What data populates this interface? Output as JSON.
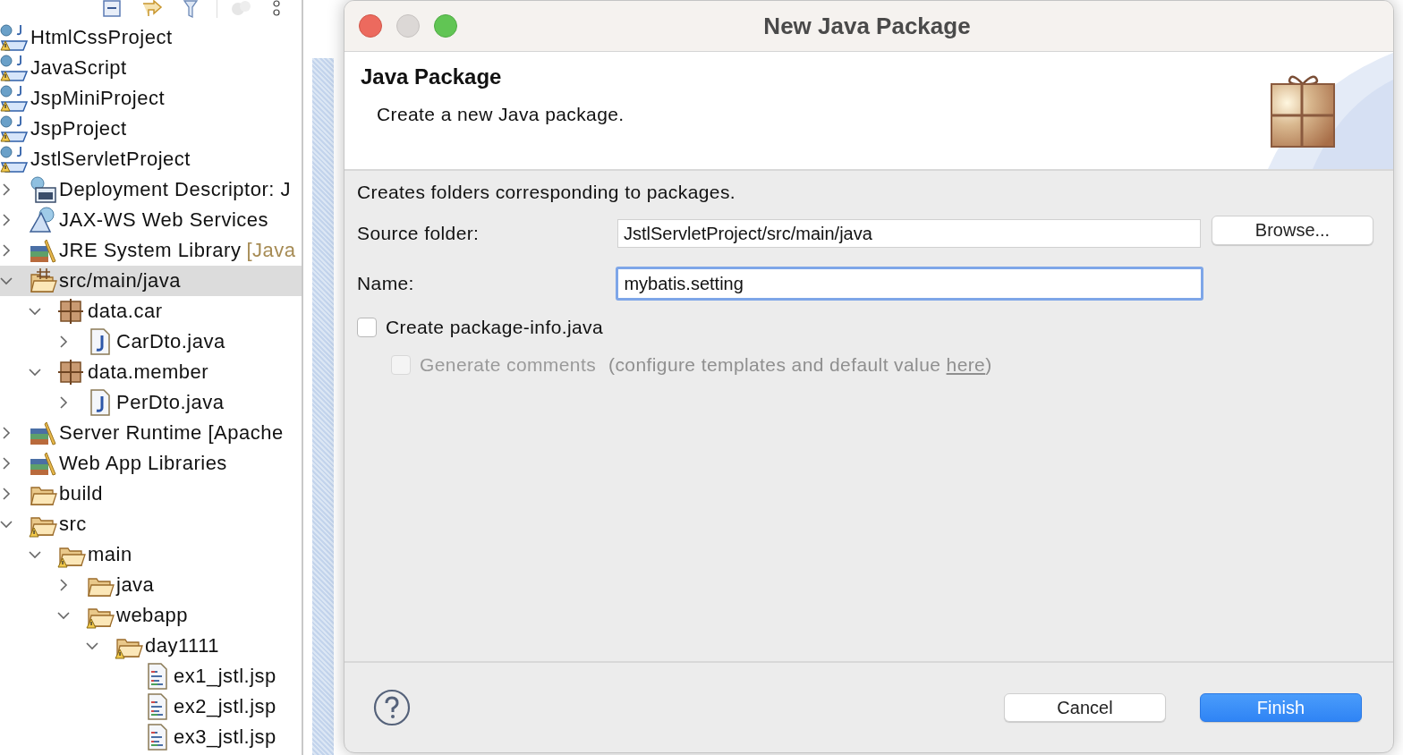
{
  "explorer": {
    "toolbar": [
      {
        "kind": "collapse"
      },
      {
        "kind": "link"
      },
      {
        "kind": "filter"
      },
      {
        "kind": "focus",
        "disabled": true
      },
      {
        "kind": "menu"
      }
    ],
    "tree": [
      {
        "label": "HtmlCssProject",
        "kind": "project",
        "selected": false
      },
      {
        "label": "JavaScript",
        "kind": "project",
        "selected": false
      },
      {
        "label": "JspMiniProject",
        "kind": "project",
        "selected": false
      },
      {
        "label": "JspProject",
        "kind": "project",
        "selected": false
      },
      {
        "label": "JstlServletProject",
        "kind": "project",
        "selected": false,
        "children": [
          {
            "label": "Deployment Descriptor: J",
            "kind": "descriptor",
            "expanded": false,
            "selected": false
          },
          {
            "label": "JAX-WS Web Services",
            "kind": "webservice",
            "expanded": false,
            "selected": false
          },
          {
            "label": "JRE System Library",
            "decoration": "[Java",
            "kind": "library",
            "expanded": false,
            "selected": false
          },
          {
            "label": "src/main/java",
            "kind": "source",
            "expanded": true,
            "selected": true,
            "children": [
              {
                "label": "data.car",
                "kind": "package",
                "expanded": true,
                "selected": false,
                "children": [
                  {
                    "label": "CarDto.java",
                    "kind": "java",
                    "expanded": false,
                    "selected": false
                  }
                ]
              },
              {
                "label": "data.member",
                "kind": "package",
                "expanded": true,
                "selected": false,
                "children": [
                  {
                    "label": "PerDto.java",
                    "kind": "java",
                    "expanded": false,
                    "selected": false
                  }
                ]
              }
            ]
          },
          {
            "label": "Server Runtime [Apache",
            "kind": "library",
            "expanded": false,
            "selected": false
          },
          {
            "label": "Web App Libraries",
            "kind": "library",
            "expanded": false,
            "selected": false
          },
          {
            "label": "build",
            "kind": "folder",
            "expanded": false,
            "selected": false
          },
          {
            "label": "src",
            "kind": "folder-warning",
            "expanded": true,
            "selected": false,
            "children": [
              {
                "label": "main",
                "kind": "folder-warning",
                "expanded": true,
                "selected": false,
                "children": [
                  {
                    "label": "java",
                    "kind": "folder",
                    "expanded": false,
                    "selected": false
                  },
                  {
                    "label": "webapp",
                    "kind": "folder-warning",
                    "expanded": true,
                    "selected": false,
                    "children": [
                      {
                        "label": "day1111",
                        "kind": "folder-warning",
                        "expanded": true,
                        "selected": false,
                        "children": [
                          {
                            "label": "ex1_jstl.jsp",
                            "kind": "jsp",
                            "selected": false
                          },
                          {
                            "label": "ex2_jstl.jsp",
                            "kind": "jsp",
                            "selected": false
                          },
                          {
                            "label": "ex3_jstl.jsp",
                            "kind": "jsp",
                            "selected": false
                          }
                        ]
                      }
                    ]
                  }
                ]
              }
            ]
          }
        ]
      }
    ]
  },
  "dialog": {
    "window": {
      "title": "New Java Package"
    },
    "header": {
      "title": "Java Package",
      "message": "Create a new Java package."
    },
    "description": "Creates folders corresponding to packages.",
    "fields": [
      {
        "label": "Source folder:",
        "value": "JstlServletProject/src/main/java",
        "focused": false,
        "button": "Browse..."
      },
      {
        "label": "Name:",
        "value": "mybatis.setting",
        "focused": true
      }
    ],
    "options": [
      {
        "label": "Create package-info.java",
        "checked": false,
        "disabled": false
      },
      {
        "label": "Generate comments",
        "checked": false,
        "disabled": true,
        "hint_before": "(configure templates and default value ",
        "hint_link": "here",
        "hint_after": ")"
      }
    ],
    "buttons": [
      {
        "label": "Cancel",
        "default": false
      },
      {
        "label": "Finish",
        "default": true
      }
    ]
  }
}
